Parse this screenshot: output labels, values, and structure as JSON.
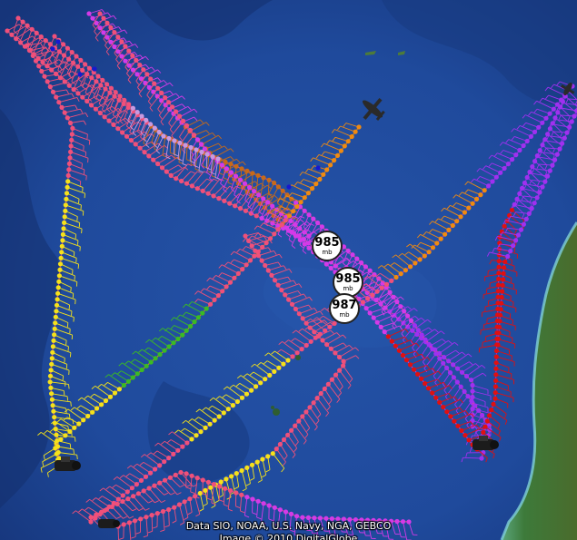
{
  "map": {
    "pressure_markers": [
      {
        "value": "985",
        "unit": "mb"
      },
      {
        "value": "985",
        "unit": "mb"
      },
      {
        "value": "987",
        "unit": "mb"
      }
    ],
    "attribution": {
      "line1": "Data SIO, NOAA, U.S. Navy, NGA, GEBCO",
      "line2": "Image © 2010 DigitalGlobe"
    },
    "colors": {
      "ocean_deep": "#16357a",
      "ocean": "#1f4a9c",
      "land": "#3d7a3a",
      "track_pink": "#f0507a",
      "track_magenta": "#d43ae8",
      "track_purple": "#a030f0",
      "track_red": "#e01010",
      "track_orange": "#f08a10",
      "track_yellow": "#f5e21a",
      "track_green": "#3bbb22",
      "track_brown": "#c86a18",
      "track_lavender": "#c89ae0",
      "track_blue": "#1818d0"
    },
    "icons": [
      "aircraft-icon",
      "ship-icon",
      "island-icon",
      "pressure-marker"
    ]
  }
}
